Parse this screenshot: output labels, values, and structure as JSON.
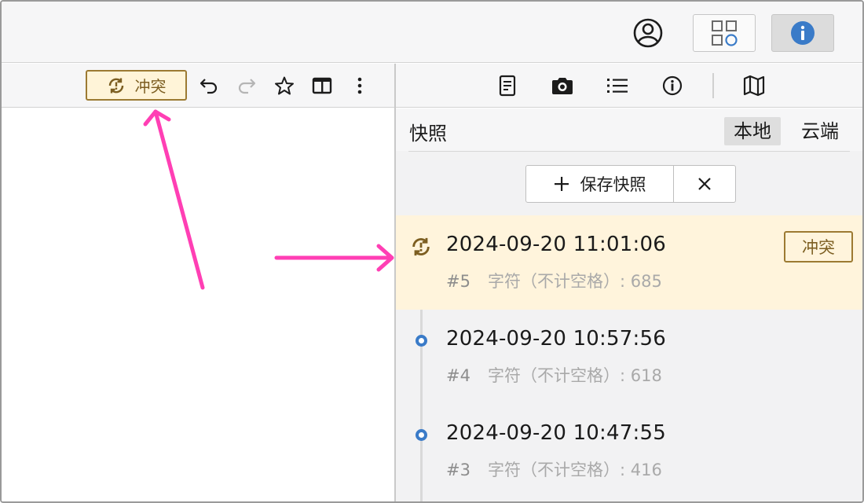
{
  "topbar": {
    "account_icon": "user-circle-icon",
    "apps_icon": "apps-grid-icon",
    "info_icon": "info-circle-icon"
  },
  "left_toolbar": {
    "conflict_label": "冲突",
    "icons": [
      "undo-icon",
      "redo-icon",
      "star-icon",
      "split-view-icon",
      "more-vertical-icon"
    ]
  },
  "right_toolbar": {
    "icons": [
      "document-icon",
      "camera-icon",
      "list-icon",
      "info-icon",
      "map-icon"
    ]
  },
  "panel": {
    "title": "快照",
    "tabs": [
      {
        "label": "本地",
        "active": true
      },
      {
        "label": "云端",
        "active": false
      }
    ],
    "save_label": "保存快照"
  },
  "snapshots": [
    {
      "time": "2024-09-20 11:01:06",
      "num": "#5",
      "meta": "字符（不计空格）: 685",
      "conflict": true,
      "badge": "冲突"
    },
    {
      "time": "2024-09-20 10:57:56",
      "num": "#4",
      "meta": "字符（不计空格）: 618",
      "conflict": false
    },
    {
      "time": "2024-09-20 10:47:55",
      "num": "#3",
      "meta": "字符（不计空格）: 416",
      "conflict": false
    }
  ],
  "colors": {
    "accent_blue": "#3a7bc8",
    "conflict_gold": "#9c7a32",
    "conflict_bg": "#fff4dc",
    "annotation_pink": "#ff3fb4"
  }
}
